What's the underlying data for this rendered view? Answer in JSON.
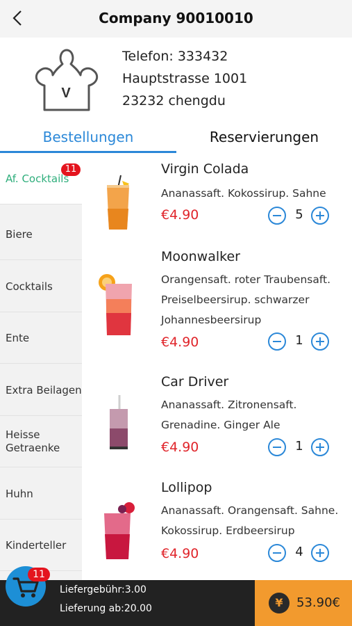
{
  "header": {
    "title": "Company 90010010",
    "back_icon": "chevron-left-icon"
  },
  "company": {
    "logo_letter": "V",
    "phone": "Telefon: 333432",
    "street": "Hauptstrasse 1001",
    "city": "23232 chengdu"
  },
  "tabs": [
    {
      "label": "Bestellungen",
      "active": true
    },
    {
      "label": "Reservierungen",
      "active": false
    }
  ],
  "categories": [
    {
      "label": "Af. Cocktails",
      "badge": "11",
      "active": true
    },
    {
      "label": "Biere"
    },
    {
      "label": "Cocktails"
    },
    {
      "label": "Ente"
    },
    {
      "label": "Extra Beilagen"
    },
    {
      "label": "Heisse Getraenke"
    },
    {
      "label": "Huhn"
    },
    {
      "label": "Kinderteller"
    }
  ],
  "items": [
    {
      "name": "Virgin Colada",
      "desc": "Ananassaft. Kokossirup. Sahne",
      "price": "€4.90",
      "qty": "5"
    },
    {
      "name": "Moonwalker",
      "desc": "Orangensaft. roter Traubensaft. Preiselbeersirup. schwarzer Johannesbeersirup",
      "price": "€4.90",
      "qty": "1"
    },
    {
      "name": "Car Driver",
      "desc": "Ananassaft. Zitronensaft. Grenadine. Ginger Ale",
      "price": "€4.90",
      "qty": "1"
    },
    {
      "name": "Lollipop",
      "desc": "Ananassaft. Orangensaft. Sahne. Kokossirup. Erdbeersirup",
      "price": "€4.90",
      "qty": "4"
    }
  ],
  "cart": {
    "badge": "11",
    "delivery_fee": "Liefergebühr:3.00",
    "min_order": "Lieferung ab:20.00",
    "total": "53.90€",
    "currency_icon": "¥"
  },
  "colors": {
    "accent": "#2b88d8",
    "price": "#e0252b",
    "badge": "#e4141e",
    "active_category": "#2fae7c",
    "checkout": "#f29a2e",
    "bottom_bar": "#222222"
  }
}
